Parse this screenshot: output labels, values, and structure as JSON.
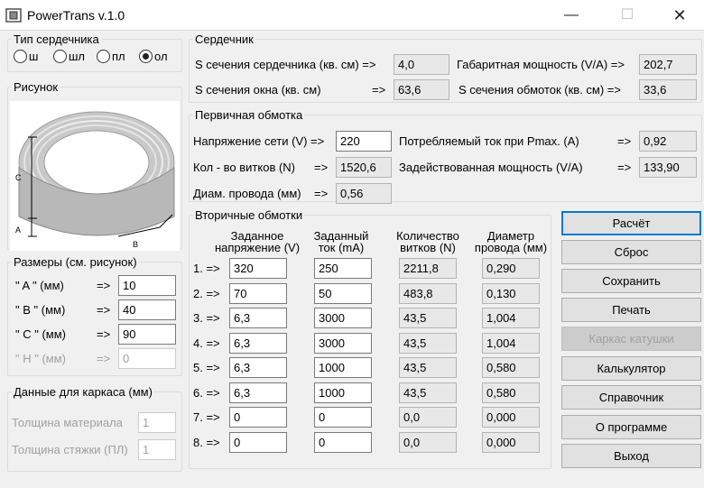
{
  "window": {
    "title": "PowerTrans v.1.0"
  },
  "core_type": {
    "legend": "Тип сердечника",
    "options": [
      {
        "label": "ш",
        "selected": false
      },
      {
        "label": "шл",
        "selected": false
      },
      {
        "label": "пл",
        "selected": false
      },
      {
        "label": "ол",
        "selected": true
      }
    ]
  },
  "picture": {
    "legend": "Рисунок",
    "dim_labels": {
      "a": "A",
      "b": "B",
      "c": "C"
    }
  },
  "dimensions": {
    "legend": "Размеры (см. рисунок)",
    "rows": [
      {
        "label": "\" A \"  (мм)",
        "arrow": "=>",
        "value": "10",
        "enabled": true
      },
      {
        "label": "\" B \"  (мм)",
        "arrow": "=>",
        "value": "40",
        "enabled": true
      },
      {
        "label": "\" C \"  (мм)",
        "arrow": "=>",
        "value": "90",
        "enabled": true
      },
      {
        "label": "\" H \"  (мм)",
        "arrow": "=>",
        "value": "0",
        "enabled": false
      }
    ]
  },
  "frame_data": {
    "legend": "Данные для каркаса (мм)",
    "rows": [
      {
        "label": "Толщина материала",
        "value": "1"
      },
      {
        "label": "Толщина стяжки (ПЛ)",
        "value": "1"
      }
    ]
  },
  "core": {
    "legend": "Сердечник",
    "rows": [
      {
        "label": "S сечения сердечника (кв. см) =>",
        "value": "4,0"
      },
      {
        "label": "S сечения окна (кв. см)",
        "arrow": "=>",
        "value": "63,6"
      }
    ],
    "right_rows": [
      {
        "label": "Габаритная мощность (V/A) =>",
        "value": "202,7"
      },
      {
        "label": "S сечения обмоток (кв. см) =>",
        "value": "33,6"
      }
    ]
  },
  "primary": {
    "legend": "Первичная обмотка",
    "voltage": {
      "label": "Напряжение сети (V) =>",
      "value": "220"
    },
    "turns": {
      "label": "Кол - во витков (N)",
      "arrow": "=>",
      "value": "1520,6"
    },
    "wire": {
      "label": "Диам. провода (мм)",
      "arrow": "=>",
      "value": "0,56"
    },
    "current": {
      "label": "Потребляемый ток при Pmax. (A)",
      "arrow": "=>",
      "value": "0,92"
    },
    "power": {
      "label": "Задействованная мощность (V/A)",
      "arrow": "=>",
      "value": "133,90"
    }
  },
  "secondary": {
    "legend": "Вторичные обмотки",
    "headers": {
      "voltage": [
        "Заданное",
        "напряжение (V)"
      ],
      "current": [
        "Заданный",
        "ток (mA)"
      ],
      "turns": [
        "Количество",
        "витков (N)"
      ],
      "diameter": [
        "Диаметр",
        "провода (мм)"
      ]
    },
    "rows": [
      {
        "label": "1. =>",
        "voltage": "320",
        "current": "250",
        "turns": "2211,8",
        "diameter": "0,290"
      },
      {
        "label": "2. =>",
        "voltage": "70",
        "current": "50",
        "turns": "483,8",
        "diameter": "0,130"
      },
      {
        "label": "3. =>",
        "voltage": "6,3",
        "current": "3000",
        "turns": "43,5",
        "diameter": "1,004"
      },
      {
        "label": "4. =>",
        "voltage": "6,3",
        "current": "3000",
        "turns": "43,5",
        "diameter": "1,004"
      },
      {
        "label": "5. =>",
        "voltage": "6,3",
        "current": "1000",
        "turns": "43,5",
        "diameter": "0,580"
      },
      {
        "label": "6. =>",
        "voltage": "6,3",
        "current": "1000",
        "turns": "43,5",
        "diameter": "0,580"
      },
      {
        "label": "7. =>",
        "voltage": "0",
        "current": "0",
        "turns": "0,0",
        "diameter": "0,000"
      },
      {
        "label": "8. =>",
        "voltage": "0",
        "current": "0",
        "turns": "0,0",
        "diameter": "0,000"
      }
    ]
  },
  "buttons": [
    {
      "name": "calculate-button",
      "label": "Расчёт",
      "enabled": true
    },
    {
      "name": "reset-button",
      "label": "Сброс",
      "enabled": true
    },
    {
      "name": "save-button",
      "label": "Сохранить",
      "enabled": true
    },
    {
      "name": "print-button",
      "label": "Печать",
      "enabled": true
    },
    {
      "name": "coil-frame-button",
      "label": "Каркас катушки",
      "enabled": false
    },
    {
      "name": "calculator-button",
      "label": "Калькулятор",
      "enabled": true
    },
    {
      "name": "reference-button",
      "label": "Справочник",
      "enabled": true
    },
    {
      "name": "about-button",
      "label": "О программе",
      "enabled": true
    },
    {
      "name": "exit-button",
      "label": "Выход",
      "enabled": true
    }
  ],
  "icons": {
    "app": "transformer-app-icon",
    "minimize": "minimize-icon",
    "maximize": "maximize-icon",
    "close": "close-icon"
  },
  "colors": {
    "accent": "#0078d7",
    "readonly_bg": "#e8e8e8",
    "window_bg": "#f0f0f0"
  }
}
